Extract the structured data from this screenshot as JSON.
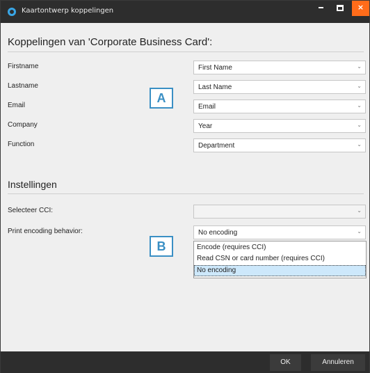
{
  "window": {
    "title": "Kaartontwerp koppelingen",
    "minimize_label": "–",
    "close_label": "×"
  },
  "mappings": {
    "heading": "Koppelingen van 'Corporate Business Card':",
    "rows": [
      {
        "label": "Firstname",
        "value": "First Name"
      },
      {
        "label": "Lastname",
        "value": "Last Name"
      },
      {
        "label": "Email",
        "value": "Email"
      },
      {
        "label": "Company",
        "value": "Year"
      },
      {
        "label": "Function",
        "value": "Department"
      }
    ]
  },
  "settings": {
    "heading": "Instellingen",
    "cci_label": "Selecteer CCI:",
    "cci_value": "",
    "encoding_label": "Print encoding behavior:",
    "encoding_value": "No encoding",
    "encoding_options": [
      "Encode (requires CCI)",
      "Read CSN or card number (requires CCI)",
      "No encoding"
    ]
  },
  "markers": {
    "a": "A",
    "b": "B"
  },
  "footer": {
    "ok_label": "OK",
    "cancel_label": "Annuleren"
  },
  "icons": {
    "chevron": "chevron-down-icon",
    "app": "app-logo-icon"
  },
  "colors": {
    "titlebar": "#2d2d2d",
    "close": "#ff6c1a",
    "marker": "#3a8fc4",
    "selected_option": "#cde8fb"
  }
}
